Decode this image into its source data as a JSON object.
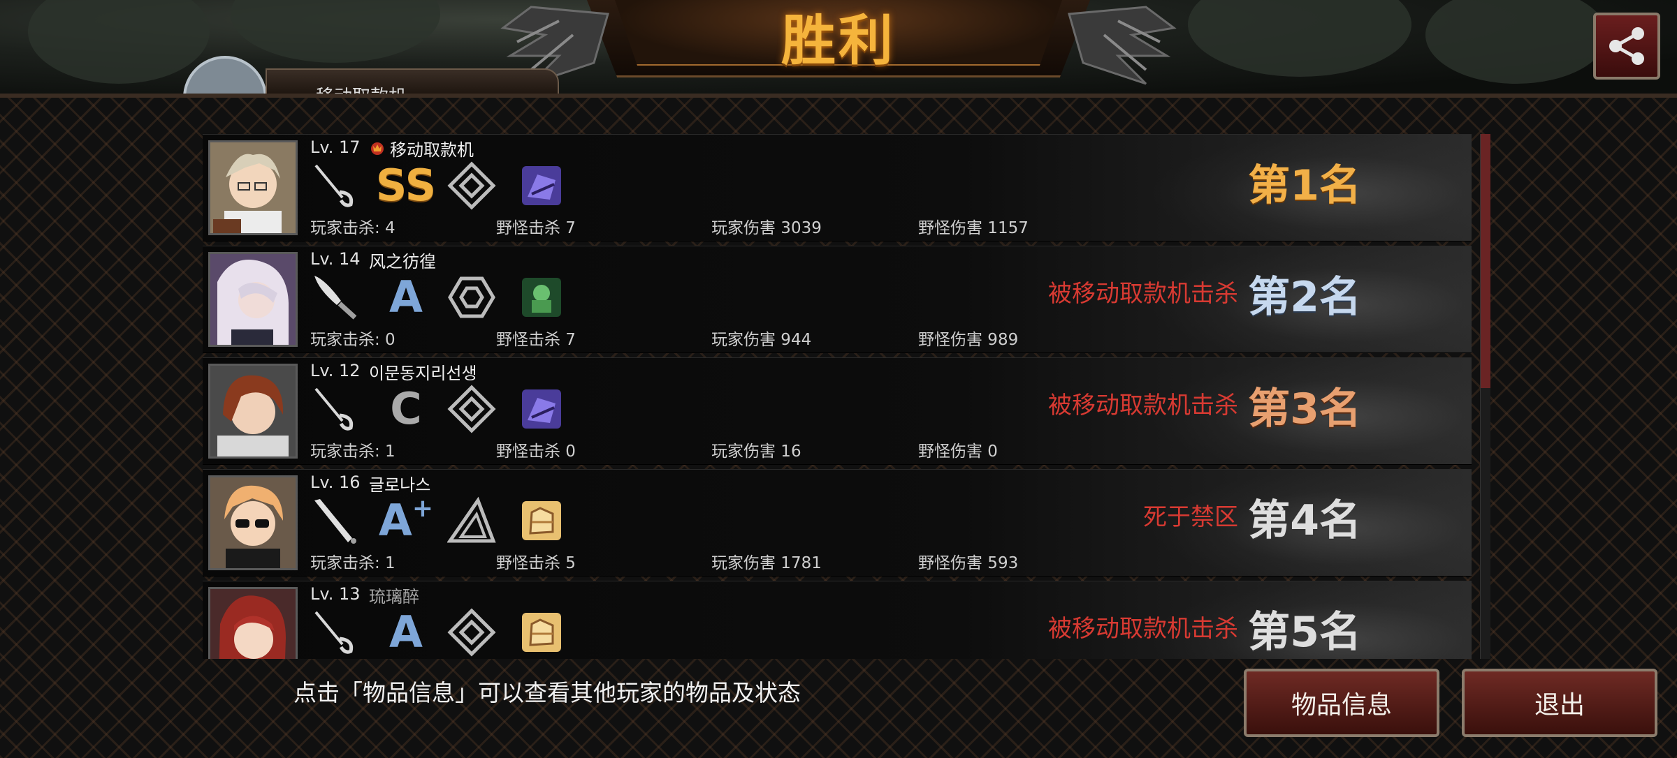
{
  "header": {
    "title": "胜利",
    "player_tab_label": "移动取款机",
    "share_icon": "share-icon"
  },
  "players": [
    {
      "level": "Lv. 17",
      "name": "移动取款机",
      "has_crown": true,
      "grade": "SS",
      "weapon_icon": "rapier-icon",
      "shape_icon": "diamond-icon",
      "item_icon": "purple-armor-icon",
      "player_kills": "玩家击杀: 4",
      "monster_kills": "野怪击杀 7",
      "player_damage": "玩家伤害 3039",
      "monster_damage": "野怪伤害 1157",
      "death_cause": "",
      "rank": "第1名"
    },
    {
      "level": "Lv. 14",
      "name": "风之彷徨",
      "has_crown": false,
      "grade": "A",
      "weapon_icon": "dagger-icon",
      "shape_icon": "hexagon-icon",
      "item_icon": "green-armor-icon",
      "player_kills": "玩家击杀: 0",
      "monster_kills": "野怪击杀 7",
      "player_damage": "玩家伤害 944",
      "monster_damage": "野怪伤害 989",
      "death_cause": "被移动取款机击杀",
      "rank": "第2名"
    },
    {
      "level": "Lv. 12",
      "name": "이문동지리선생",
      "has_crown": false,
      "grade": "C",
      "weapon_icon": "rapier-icon",
      "shape_icon": "diamond-icon",
      "item_icon": "purple-armor-icon",
      "player_kills": "玩家击杀: 1",
      "monster_kills": "野怪击杀 0",
      "player_damage": "玩家伤害 16",
      "monster_damage": "野怪伤害 0",
      "death_cause": "被移动取款机击杀",
      "rank": "第3名"
    },
    {
      "level": "Lv. 16",
      "name": "글로나스",
      "has_crown": false,
      "grade": "A",
      "grade_plus": "+",
      "weapon_icon": "bat-icon",
      "shape_icon": "triangle-icon",
      "item_icon": "gold-glove-icon",
      "player_kills": "玩家击杀: 1",
      "monster_kills": "野怪击杀 5",
      "player_damage": "玩家伤害 1781",
      "monster_damage": "野怪伤害 593",
      "death_cause": "死于禁区",
      "rank": "第4名"
    },
    {
      "level": "Lv. 13",
      "name": "琉璃醉",
      "has_crown": false,
      "grade": "A",
      "weapon_icon": "rapier-icon",
      "shape_icon": "diamond-icon",
      "item_icon": "gold-glove-icon",
      "player_kills": "",
      "monster_kills": "",
      "player_damage": "",
      "monster_damage": "",
      "death_cause": "被移动取款机击杀",
      "rank": "第5名"
    }
  ],
  "footer": {
    "hint": "点击「物品信息」可以查看其他玩家的物品及状态",
    "items_button": "物品信息",
    "exit_button": "退出"
  },
  "colors": {
    "title": "#f5b43c",
    "death_text": "#d83a32",
    "button_bg": "#6e2a24",
    "scroll_thumb": "#6a2424"
  }
}
